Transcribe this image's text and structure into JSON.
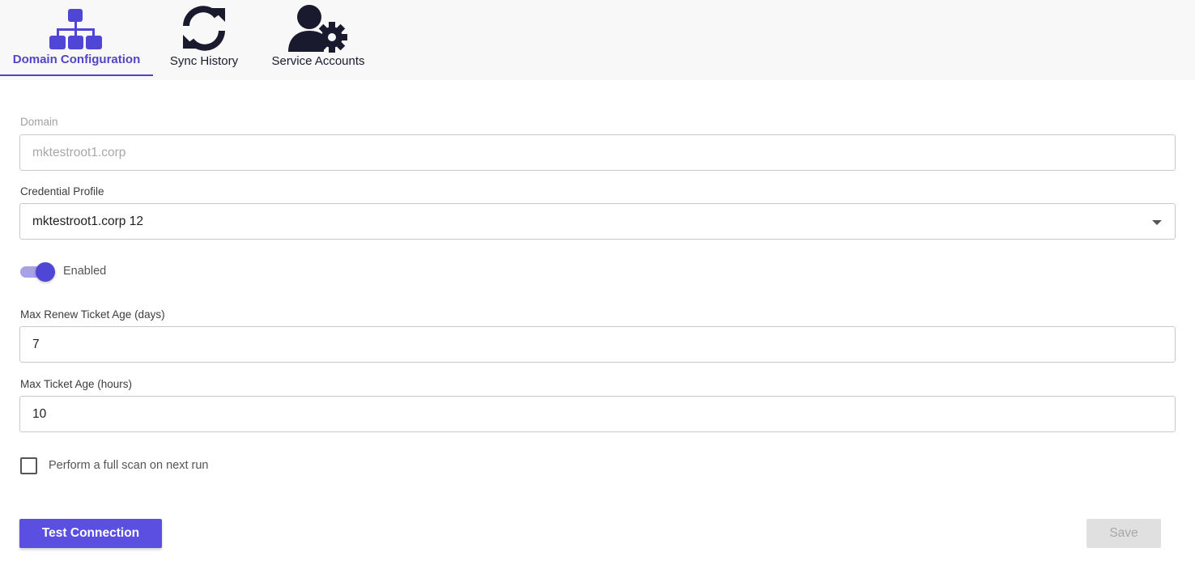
{
  "tabs": [
    {
      "label": "Domain Configuration",
      "icon": "sitemap-icon",
      "active": true
    },
    {
      "label": "Sync History",
      "icon": "sync-icon",
      "active": false
    },
    {
      "label": "Service Accounts",
      "icon": "user-gear-icon",
      "active": false
    }
  ],
  "form": {
    "domain": {
      "label": "Domain",
      "value": "mktestroot1.corp",
      "disabled": true
    },
    "credential_profile": {
      "label": "Credential Profile",
      "value": "mktestroot1.corp 12"
    },
    "enabled": {
      "label": "Enabled",
      "on": true
    },
    "max_renew_ticket_age": {
      "label": "Max Renew Ticket Age (days)",
      "value": "7"
    },
    "max_ticket_age": {
      "label": "Max Ticket Age (hours)",
      "value": "10"
    },
    "full_scan": {
      "label": "Perform a full scan on next run",
      "checked": false
    }
  },
  "actions": {
    "test_connection": "Test Connection",
    "save": "Save"
  },
  "colors": {
    "accent": "#5046c4",
    "primary_button": "#5a4fe0",
    "icon_dark": "#1a1a2e"
  }
}
